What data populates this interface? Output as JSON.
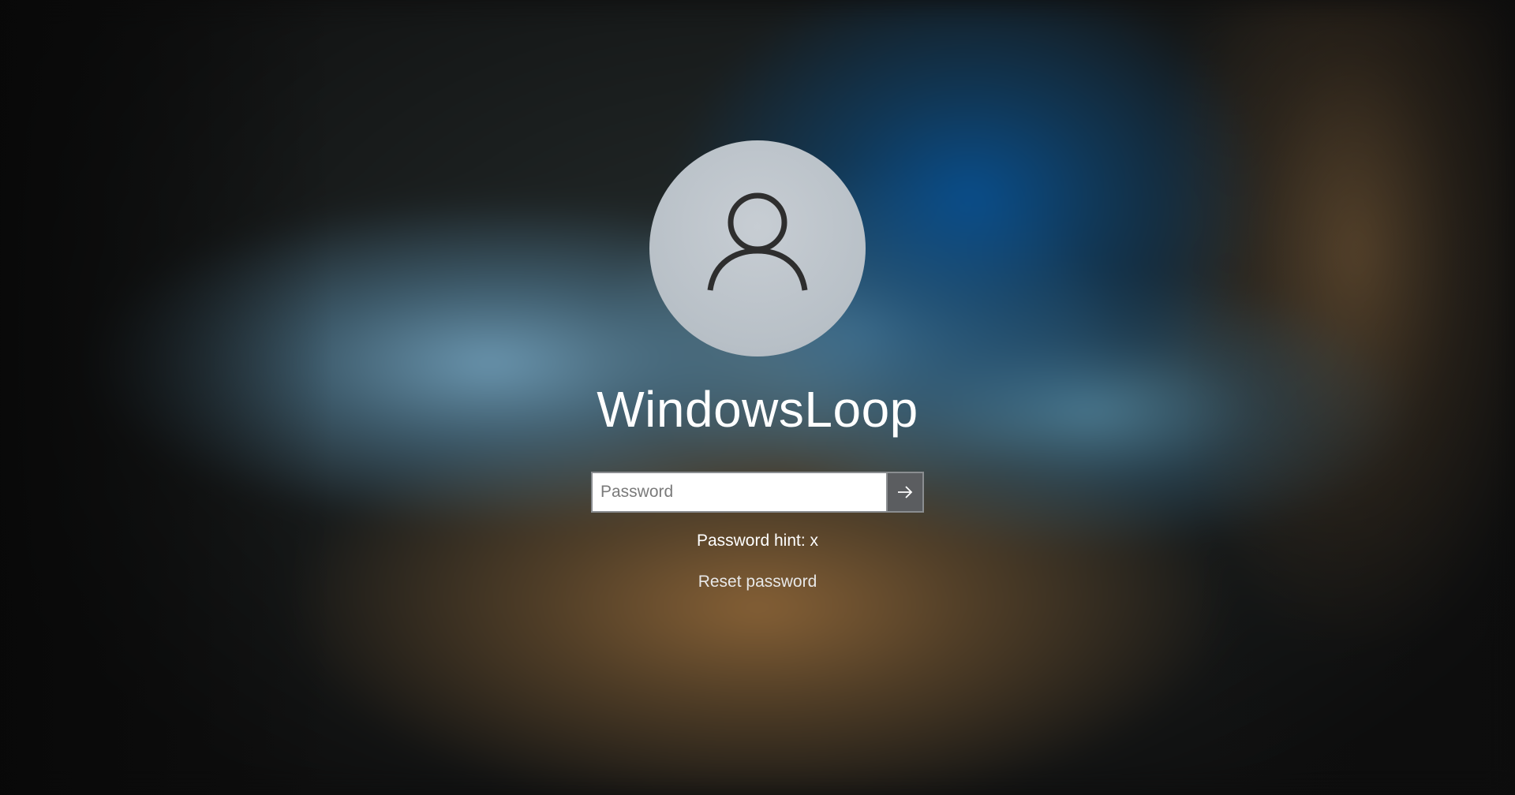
{
  "user": {
    "name": "WindowsLoop",
    "avatar_icon": "user-silhouette-icon"
  },
  "password": {
    "value": "",
    "placeholder": "Password",
    "submit_icon": "arrow-right-icon"
  },
  "hint": {
    "text": "Password hint: x"
  },
  "reset": {
    "label": "Reset password"
  },
  "colors": {
    "avatar_bg": "#b9c1c8",
    "submit_bg": "#5b5d60",
    "text": "#ffffff"
  }
}
